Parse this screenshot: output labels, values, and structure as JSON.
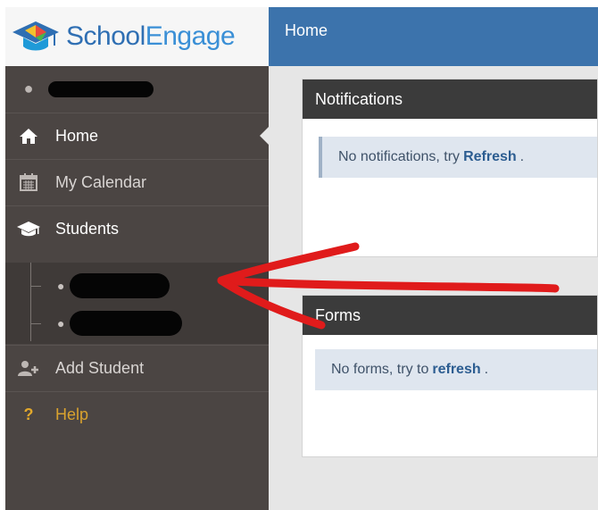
{
  "app": {
    "brand_part1": "School",
    "brand_part2": "Engage"
  },
  "header": {
    "title": "Home"
  },
  "sidebar": {
    "items": [
      {
        "label": "Home",
        "icon": "home-icon"
      },
      {
        "label": "My Calendar",
        "icon": "calendar-icon"
      },
      {
        "label": "Students",
        "icon": "graduation-cap-icon"
      },
      {
        "label": "Add Student",
        "icon": "add-user-icon"
      },
      {
        "label": "Help",
        "icon": "question-icon"
      }
    ]
  },
  "notifications": {
    "title": "Notifications",
    "message": "No notifications, try",
    "link": "Refresh",
    "end": "."
  },
  "forms": {
    "title": "Forms",
    "message": "No forms, try to",
    "link": "refresh",
    "end": "."
  },
  "colors": {
    "accent": "#3c73ac",
    "sidebar": "#4b4543",
    "annotation": "#e01b1b"
  }
}
